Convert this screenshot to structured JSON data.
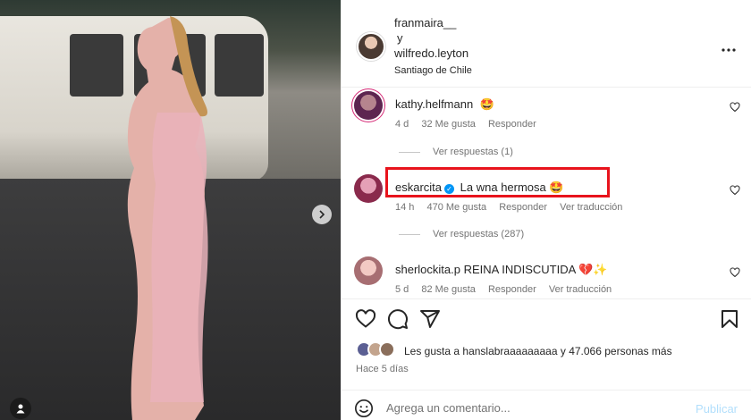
{
  "header": {
    "user1": "franmaira__",
    "conjunction": "y",
    "user2": "wilfredo.leyton",
    "location": "Santiago de Chile",
    "more_icon": "more-horizontal-icon"
  },
  "comments": [
    {
      "user": "kathy.helfmann",
      "text": "🤩",
      "time": "4 d",
      "likes": "32 Me gusta",
      "reply": "Responder",
      "translate": "",
      "replies": "Ver respuestas (1)"
    },
    {
      "user": "eskarcita",
      "verified": true,
      "text": "La wna hermosa 🤩",
      "time": "14 h",
      "likes": "470 Me gusta",
      "reply": "Responder",
      "translate": "Ver traducción",
      "replies": "Ver respuestas (287)"
    },
    {
      "user": "sherlockita.p",
      "text": "REINA INDISCUTIDA 💔✨",
      "time": "5 d",
      "likes": "82 Me gusta",
      "reply": "Responder",
      "translate": "Ver traducción"
    }
  ],
  "likes": {
    "prefix": "Les gusta a",
    "user": "hanslabraaaaaaaaa",
    "connector": "y",
    "others": "47.066 personas más"
  },
  "time_ago": "Hace 5 días",
  "composer": {
    "placeholder": "Agrega un comentario...",
    "publish": "Publicar"
  },
  "colors": {
    "highlight": "#e8131c",
    "link_blue": "#0095f6",
    "publish_disabled": "#b2dffc",
    "muted": "#737373"
  }
}
